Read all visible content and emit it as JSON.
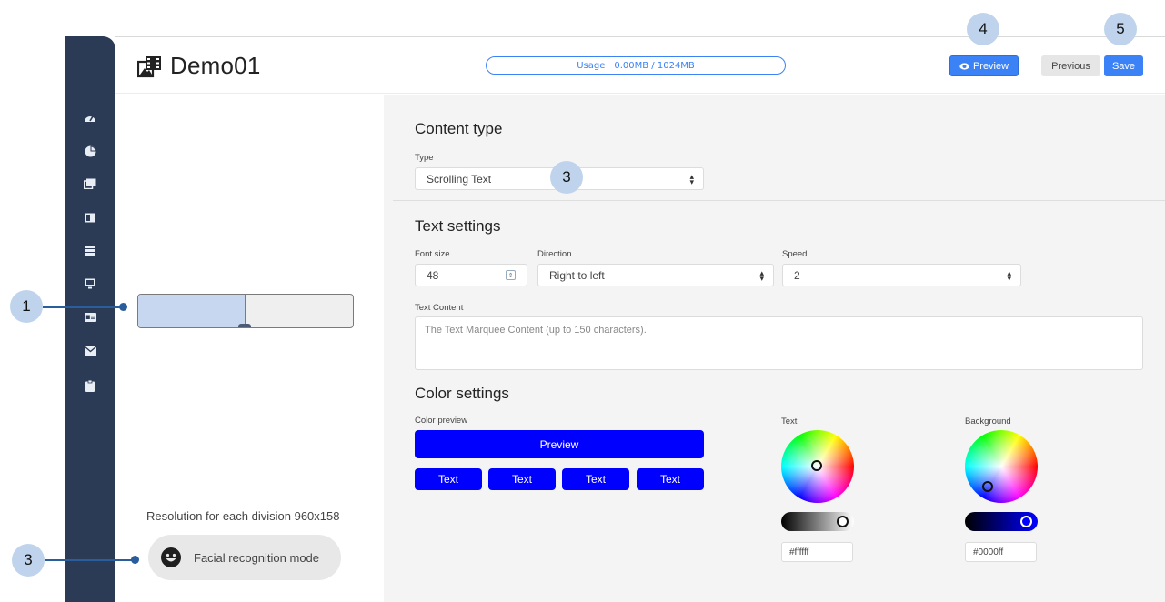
{
  "header": {
    "title": "Demo01",
    "usage_label": "Usage",
    "usage_value": "0.00MB / 1024MB",
    "preview_label": "Preview",
    "previous_label": "Previous",
    "save_label": "Save"
  },
  "sidebar": {
    "items": [
      {
        "icon": "dashboard-icon"
      },
      {
        "icon": "pie-chart-icon"
      },
      {
        "icon": "media-icon"
      },
      {
        "icon": "layout-icon"
      },
      {
        "icon": "list-icon"
      },
      {
        "icon": "monitor-icon"
      },
      {
        "icon": "id-card-icon"
      },
      {
        "icon": "mail-icon"
      },
      {
        "icon": "clipboard-icon"
      }
    ]
  },
  "left_panel": {
    "resolution_text": "Resolution for each division 960x158",
    "facial_button_label": "Facial recognition mode"
  },
  "content_type": {
    "title": "Content type",
    "type_label": "Type",
    "type_value": "Scrolling Text"
  },
  "text_settings": {
    "title": "Text settings",
    "font_size_label": "Font size",
    "font_size_value": "48",
    "direction_label": "Direction",
    "direction_value": "Right to left",
    "speed_label": "Speed",
    "speed_value": "2",
    "content_label": "Text Content",
    "content_placeholder": "The Text Marquee Content (up to 150 characters)."
  },
  "color_settings": {
    "title": "Color settings",
    "preview_label": "Color preview",
    "preview_button": "Preview",
    "chips": [
      "Text",
      "Text",
      "Text",
      "Text"
    ],
    "text_color_label": "Text",
    "text_color_hex": "#ffffff",
    "background_color_label": "Background",
    "background_color_hex": "#0000ff",
    "accent_color": "#0000ff"
  },
  "callouts": {
    "c1": "1",
    "c3_top": "3",
    "c3_bottom": "3",
    "c4": "4",
    "c5": "5"
  }
}
